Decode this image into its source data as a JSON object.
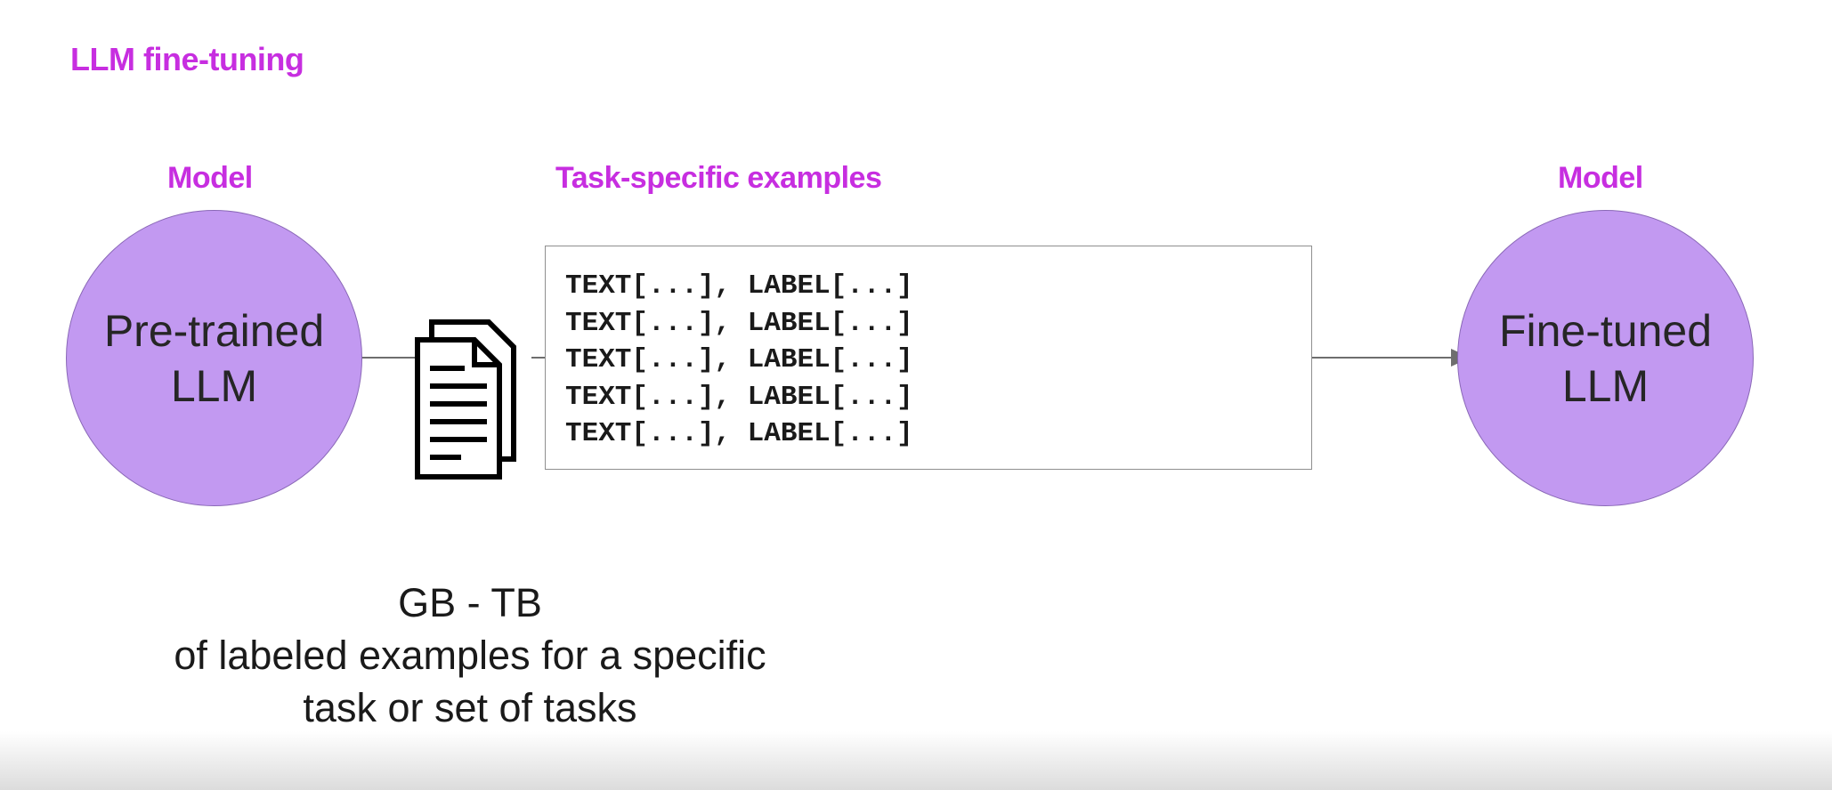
{
  "slide": {
    "title": "LLM fine-tuning"
  },
  "left_model": {
    "label": "Model",
    "name": "Pre-trained\nLLM"
  },
  "examples": {
    "label": "Task-specific examples",
    "rows": [
      "TEXT[...], LABEL[...]",
      "TEXT[...], LABEL[...]",
      "TEXT[...], LABEL[...]",
      "TEXT[...], LABEL[...]",
      "TEXT[...], LABEL[...]"
    ]
  },
  "right_model": {
    "label": "Model",
    "name": "Fine-tuned\nLLM"
  },
  "caption": {
    "line1": "GB - TB",
    "line2": "of labeled examples for a specific",
    "line3": "task or set of tasks"
  },
  "icons": {
    "documents": "documents-icon",
    "arrow": "arrow-right-icon"
  },
  "colors": {
    "accent": "#c72ee0",
    "model_fill": "#c299f1",
    "connector": "#6e6e6e"
  }
}
